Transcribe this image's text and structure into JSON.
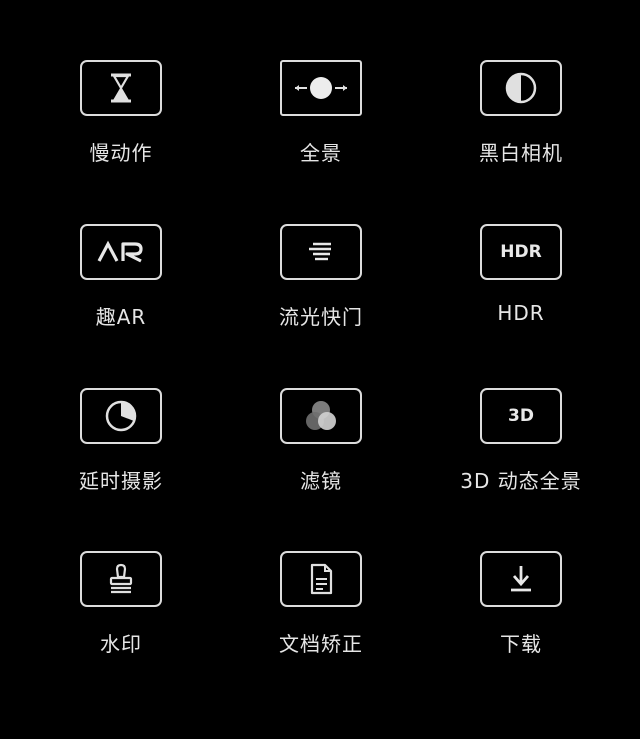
{
  "modes": [
    {
      "label": "慢动作",
      "icon": "hourglass-icon"
    },
    {
      "label": "全景",
      "icon": "panorama-icon"
    },
    {
      "label": "黑白相机",
      "icon": "half-circle-icon"
    },
    {
      "label": "趣AR",
      "icon": "ar-icon",
      "icon_text": "AR"
    },
    {
      "label": "流光快门",
      "icon": "light-trail-icon"
    },
    {
      "label": "HDR",
      "icon": "hdr-icon",
      "icon_text": "HDR"
    },
    {
      "label": "延时摄影",
      "icon": "time-lapse-icon"
    },
    {
      "label": "滤镜",
      "icon": "filter-circles-icon"
    },
    {
      "label": "3D 动态全景",
      "icon": "3d-icon",
      "icon_text": "3D"
    },
    {
      "label": "水印",
      "icon": "stamp-icon"
    },
    {
      "label": "文档矫正",
      "icon": "document-icon"
    },
    {
      "label": "下载",
      "icon": "download-icon"
    }
  ],
  "colors": {
    "background": "#000000",
    "icon_stroke": "#dcdcdc",
    "label": "#e6e6e6"
  }
}
